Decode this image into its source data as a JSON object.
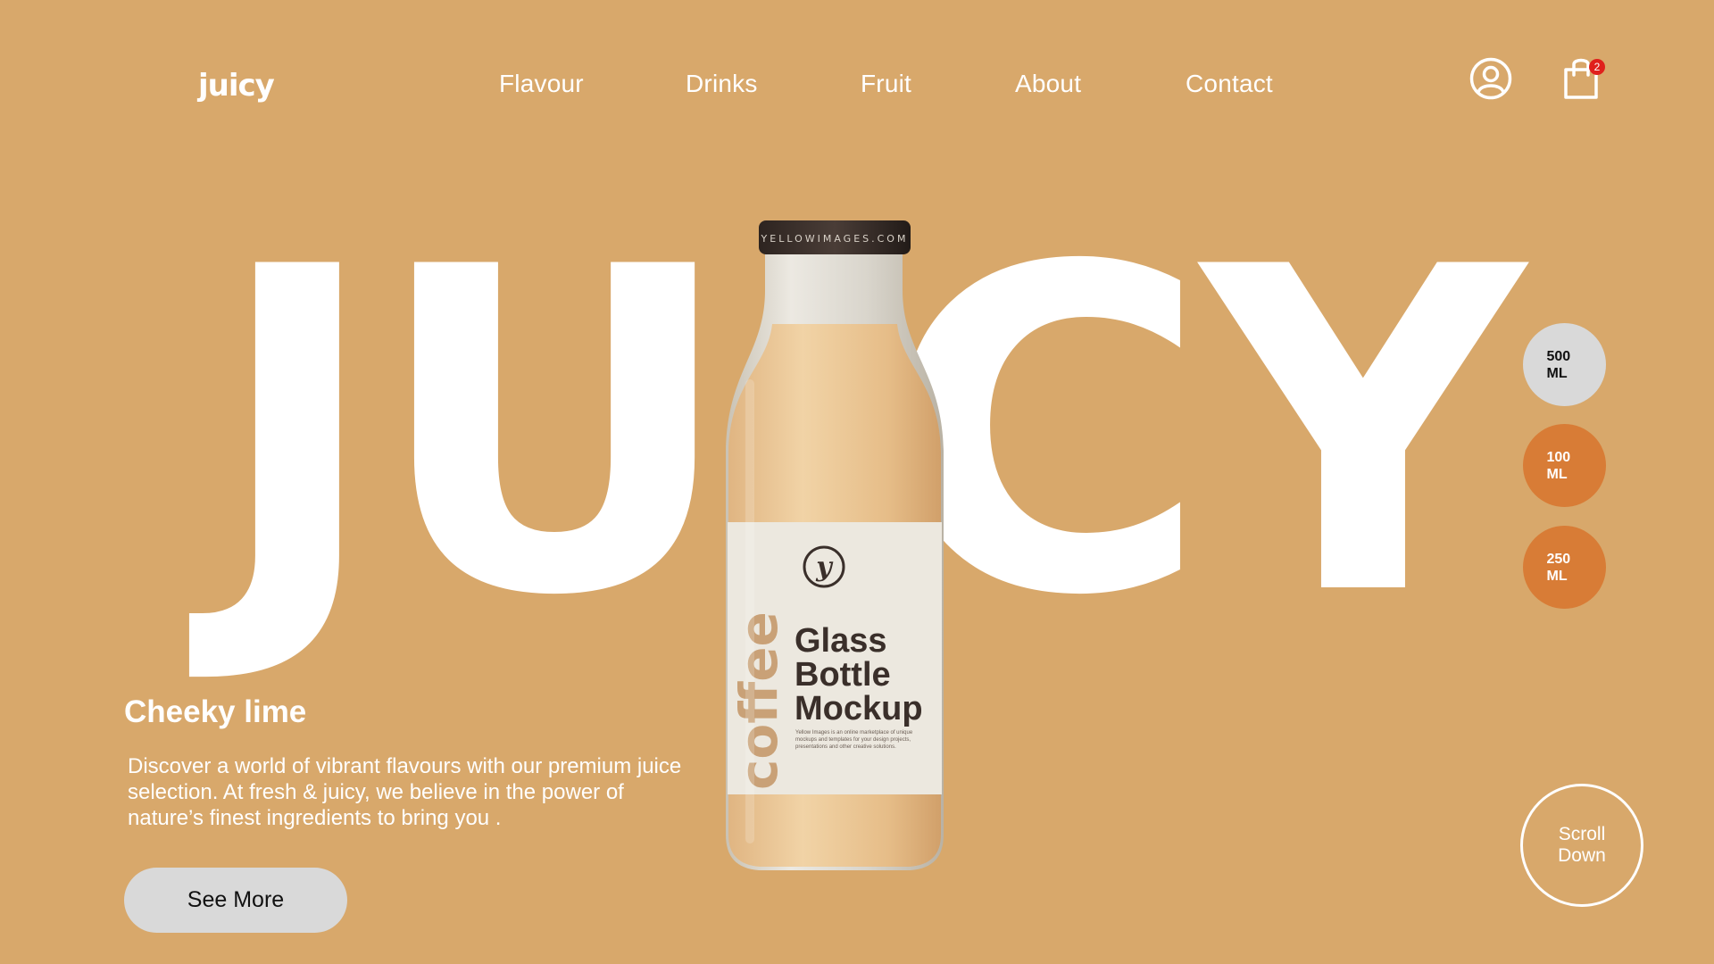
{
  "header": {
    "logo": "juicy",
    "nav": [
      "Flavour",
      "Drinks",
      "Fruit",
      "About",
      "Contact"
    ],
    "cart_count": "2",
    "user_icon": "user-circle-icon",
    "cart_icon": "shopping-bag-icon"
  },
  "hero": {
    "word_left": "JU",
    "word_right": "CY",
    "product": {
      "cap_text": "YELLOWIMAGES.COM",
      "label_vertical": "coffee",
      "label_title": [
        "Glass",
        "Bottle",
        "Mockup"
      ],
      "label_small": "Yellow Images is an online marketplace of unique mockups and templates for your design projects, presentations and other creative solutions."
    }
  },
  "sizes": [
    {
      "line1": "500",
      "line2": "ML",
      "selected": true
    },
    {
      "line1": "100",
      "line2": "ML",
      "selected": false
    },
    {
      "line1": "250",
      "line2": "ML",
      "selected": false
    }
  ],
  "content": {
    "title": "Cheeky lime",
    "description": "Discover a world of vibrant flavours with our premium juice selection. At fresh & juicy, we believe in the power of nature’s finest ingredients to bring you .",
    "cta": "See More",
    "scroll": "Scroll Down"
  },
  "colors": {
    "background": "#D8A86B",
    "accent": "#D87C36",
    "selected_size": "#D9D9D9",
    "badge": "#E0201C"
  }
}
